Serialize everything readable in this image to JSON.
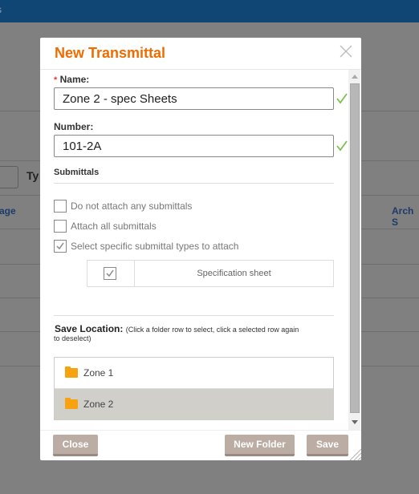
{
  "background": {
    "topbar_text": "s",
    "type_label": "Ty",
    "col_page": "age",
    "col_arch": "Arch S"
  },
  "modal": {
    "title": "New Transmittal",
    "name": {
      "required_mark": "*",
      "label": "Name:",
      "value": "Zone 2 - spec Sheets"
    },
    "number": {
      "label": "Number:",
      "value": "101-2A"
    },
    "submittals": {
      "heading": "Submittals",
      "options": [
        {
          "label": "Do not attach any submittals",
          "checked": false
        },
        {
          "label": "Attach all submittals",
          "checked": false
        },
        {
          "label": "Select specific submittal types to attach",
          "checked": true
        }
      ],
      "types": [
        {
          "label": "Specification sheet",
          "checked": true
        }
      ]
    },
    "save_location": {
      "label": "Save Location:",
      "hint_1": "(Click a folder row to select, click a selected row again",
      "hint_2": "to deselect)",
      "folders": [
        {
          "name": "Zone 1",
          "selected": false
        },
        {
          "name": "Zone 2",
          "selected": true
        }
      ]
    },
    "buttons": {
      "close": "Close",
      "new_folder": "New Folder",
      "save": "Save"
    }
  },
  "colors": {
    "accent": "#ef6c00",
    "valid": "#7cc04b",
    "folder": "#f9a20f",
    "button": "#bbaca4"
  }
}
